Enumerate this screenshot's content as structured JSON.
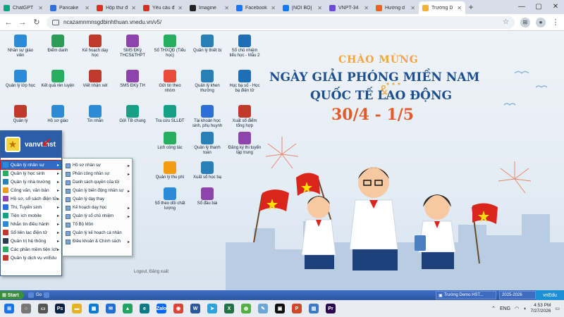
{
  "browser": {
    "tabs": [
      {
        "label": "ChatGPT",
        "color": "#10a37f"
      },
      {
        "label": "Pancake",
        "color": "#2f6fde"
      },
      {
        "label": "Hộp thư đ",
        "color": "#d93025"
      },
      {
        "label": "Yêu cầu đ",
        "color": "#d93025"
      },
      {
        "label": "Imagine",
        "color": "#222222"
      },
      {
        "label": "Facebook",
        "color": "#1877f2"
      },
      {
        "label": "[NỘI BỘ]",
        "color": "#1877f2"
      },
      {
        "label": "VNPT-34",
        "color": "#6b4bd8"
      },
      {
        "label": "Hướng d",
        "color": "#e8622b"
      },
      {
        "label": "Trường D",
        "color": "#f2b233"
      }
    ],
    "active_tab": 9,
    "url": "ncazamnmnsgdbinhthuan.vnedu.vn/v5/"
  },
  "apps": [
    {
      "label": "Nhân sự giáo viên",
      "color": "#2c8bd6",
      "col": 0,
      "row": 0
    },
    {
      "label": "Điểm danh",
      "color": "#2c9d57",
      "col": 1,
      "row": 0
    },
    {
      "label": "Kế hoạch dạy học",
      "color": "#c0392b",
      "col": 2,
      "row": 0
    },
    {
      "label": "SMS ĐKỳ THCS&THPT",
      "color": "#8e44ad",
      "col": 3,
      "row": 0
    },
    {
      "label": "Sổ THXQĐ (Tiểu học)",
      "color": "#27ae60",
      "col": 4,
      "row": 0
    },
    {
      "label": "Quản lý thiết bị",
      "color": "#2980b9",
      "col": 5,
      "row": 0
    },
    {
      "label": "Sổ chủ nhiệm tiểu học - Mẫu 2",
      "color": "#1f6fb5",
      "col": 6,
      "row": 0
    },
    {
      "label": "Quản lý lớp học",
      "color": "#2c8bd6",
      "col": 0,
      "row": 1
    },
    {
      "label": "Kết quả rèn luyện",
      "color": "#27ae60",
      "col": 1,
      "row": 1
    },
    {
      "label": "Viết nhận xét",
      "color": "#c0392b",
      "col": 2,
      "row": 1
    },
    {
      "label": "SMS ĐKỳ TH",
      "color": "#8e44ad",
      "col": 3,
      "row": 1
    },
    {
      "label": "Gửi tin theo nhóm",
      "color": "#e74c3c",
      "col": 4,
      "row": 1
    },
    {
      "label": "Quản lý khen thưởng",
      "color": "#2980b9",
      "col": 5,
      "row": 1
    },
    {
      "label": "Học bạ số - Học bạ điện tử",
      "color": "#1f6fb5",
      "col": 6,
      "row": 1
    },
    {
      "label": "Quản lý",
      "color": "#c0392b",
      "col": 0,
      "row": 2
    },
    {
      "label": "Hồ sơ giáo",
      "color": "#2c8bd6",
      "col": 1,
      "row": 2
    },
    {
      "label": "Tin nhắn",
      "color": "#2c8bd6",
      "col": 2,
      "row": 2
    },
    {
      "label": "Gửi TB chung",
      "color": "#16a085",
      "col": 3,
      "row": 2
    },
    {
      "label": "Tra cứu SLLĐT",
      "color": "#16a085",
      "col": 4,
      "row": 2
    },
    {
      "label": "Tài khoản học sinh, phụ huynh",
      "color": "#2c6fd6",
      "col": 5,
      "row": 2
    },
    {
      "label": "Xuất sổ điểm tổng hợp",
      "color": "#c0392b",
      "col": 6,
      "row": 2
    },
    {
      "label": "Lịch công tác",
      "color": "#27ae60",
      "col": 4,
      "row": 3
    },
    {
      "label": "Quản lý thanh toán",
      "color": "#2980b9",
      "col": 5,
      "row": 3
    },
    {
      "label": "Đăng ký thi tuyển tập trung",
      "color": "#8e44ad",
      "col": 6,
      "row": 3
    },
    {
      "label": "Quản lý thu phí",
      "color": "#f39c12",
      "col": 4,
      "row": 4
    },
    {
      "label": "Xuất sổ học bạ",
      "color": "#2980b9",
      "col": 5,
      "row": 4
    },
    {
      "label": "Sổ theo dõi chất lượng",
      "color": "#2c8bd6",
      "col": 4,
      "row": 5
    },
    {
      "label": "Sổ đầu bài",
      "color": "#8e44ad",
      "col": 5,
      "row": 5
    }
  ],
  "banner": {
    "line1": "CHÀO MỪNG",
    "line2": "NGÀY GIẢI PHÓNG MIỀN NAM",
    "amp": "&",
    "line3": "QUỐC TẾ LAO ĐỘNG",
    "date": "30/4 - 1/5"
  },
  "start_menu": {
    "username": "vanvt.hst",
    "items": [
      {
        "label": "Quản lý nhân sự",
        "color": "#2c8bd6",
        "arrow": "▸",
        "selected": true
      },
      {
        "label": "Quản lý học sinh",
        "color": "#27ae60",
        "arrow": "▸"
      },
      {
        "label": "Quản lý nhà trường",
        "color": "#2980b9",
        "arrow": "▸"
      },
      {
        "label": "Công văn, văn bản",
        "color": "#f39c12",
        "arrow": "▸"
      },
      {
        "label": "Hồ sơ, sổ sách điện tử",
        "color": "#8e44ad",
        "arrow": "▸"
      },
      {
        "label": "Thi, Tuyển sinh",
        "color": "#2c6fd6",
        "arrow": "▸"
      },
      {
        "label": "Tiện ích mobile",
        "color": "#16a085",
        "arrow": "▸"
      },
      {
        "label": "Nhắn tin điều hành",
        "color": "#2c8bd6",
        "arrow": "▸"
      },
      {
        "label": "Sổ liên lạc điện tử",
        "color": "#c0392b",
        "arrow": "▸"
      },
      {
        "label": "Quản trị hệ thống",
        "color": "#2c3e50",
        "arrow": "▸"
      },
      {
        "label": "Các phần mềm tiện ích",
        "color": "#27ae60",
        "arrow": "▸"
      },
      {
        "label": "Quản lý dịch vụ vnEdu",
        "color": "#c0392b",
        "arrow": ""
      }
    ],
    "submenu": [
      {
        "label": "Hồ sơ nhân sự",
        "arrow": "▸"
      },
      {
        "label": "Phân công nhân sự",
        "arrow": "▸"
      },
      {
        "label": "Danh sách quyền của tôi",
        "arrow": ""
      },
      {
        "label": "Quản lý biến động nhân sự",
        "arrow": "▸"
      },
      {
        "label": "Quản lý dạy thay",
        "arrow": ""
      },
      {
        "label": "Kế hoạch dạy học",
        "arrow": "▸"
      },
      {
        "label": "Quản lý sổ chủ nhiệm",
        "arrow": "▸"
      },
      {
        "label": "Tổ Bộ Môn",
        "arrow": ""
      },
      {
        "label": "Quản lý kế hoạch cá nhân",
        "arrow": ""
      },
      {
        "label": "Điều khoản & Chính sách",
        "arrow": "▸"
      }
    ],
    "peek_text": "Logout, Đăng xuất"
  },
  "taskbar": {
    "start_label": "Start",
    "quicklaunch": "Go",
    "task1": "Trường Demo HST...",
    "task2": "2025-2026",
    "tray": "vnEdu",
    "lang": "ENG",
    "time": "4:53 PM",
    "date": "7/27/2026",
    "apps": [
      {
        "name": "search",
        "color": "#777777",
        "glyph": "○"
      },
      {
        "name": "taskview",
        "color": "#555555",
        "glyph": "▭"
      },
      {
        "name": "photoshop",
        "color": "#0b2340",
        "glyph": "Ps"
      },
      {
        "name": "explorer",
        "color": "#e6b422",
        "glyph": "▬"
      },
      {
        "name": "store",
        "color": "#0a7cd6",
        "glyph": "▦"
      },
      {
        "name": "mail",
        "color": "#1f6fd6",
        "glyph": "✉"
      },
      {
        "name": "drive",
        "color": "#1fa463",
        "glyph": "▲"
      },
      {
        "name": "edge",
        "color": "#0e7a86",
        "glyph": "e"
      },
      {
        "name": "zalo",
        "color": "#0068ff",
        "glyph": "Zalo"
      },
      {
        "name": "chrome",
        "color": "#db4437",
        "glyph": "◉"
      },
      {
        "name": "word",
        "color": "#2b579a",
        "glyph": "W"
      },
      {
        "name": "telegram",
        "color": "#2aa3df",
        "glyph": "➤"
      },
      {
        "name": "excel",
        "color": "#217346",
        "glyph": "X"
      },
      {
        "name": "xbox",
        "color": "#52b043",
        "glyph": "◍"
      },
      {
        "name": "notepad",
        "color": "#6ba6d6",
        "glyph": "✎"
      },
      {
        "name": "capcut",
        "color": "#111111",
        "glyph": "▣"
      },
      {
        "name": "powerpoint",
        "color": "#d24726",
        "glyph": "P"
      },
      {
        "name": "photos",
        "color": "#3a7ac8",
        "glyph": "▨"
      },
      {
        "name": "premiere",
        "color": "#2a0a4d",
        "glyph": "Pr"
      }
    ]
  }
}
